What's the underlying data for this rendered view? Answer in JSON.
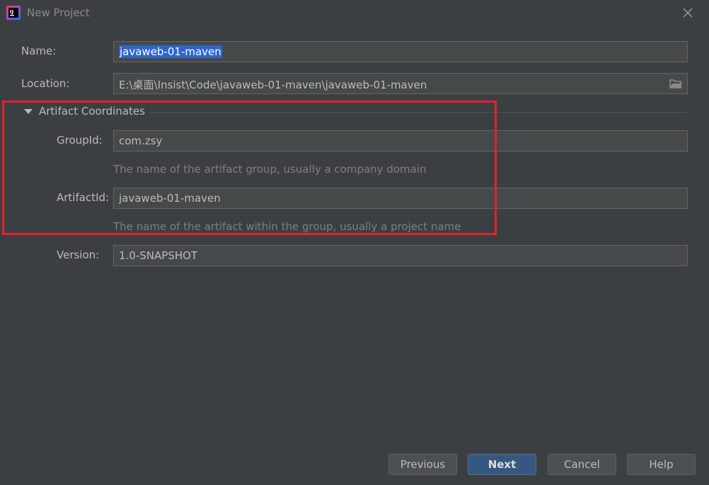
{
  "window": {
    "title": "New Project",
    "icon": "intellij-idea-icon"
  },
  "form": {
    "name_label": "Name:",
    "name_value": "javaweb-01-maven",
    "location_label": "Location:",
    "location_value": "E:\\桌面\\Insist\\Code\\javaweb-01-maven\\javaweb-01-maven",
    "section_title": "Artifact Coordinates",
    "groupid_label": "GroupId:",
    "groupid_value": "com.zsy",
    "groupid_hint": "The name of the artifact group, usually a company domain",
    "artifactid_label": "ArtifactId:",
    "artifactid_value": "javaweb-01-maven",
    "artifactid_hint": "The name of the artifact within the group, usually a project name",
    "version_label": "Version:",
    "version_value": "1.0-SNAPSHOT"
  },
  "buttons": {
    "previous": "Previous",
    "next": "Next",
    "cancel": "Cancel",
    "help": "Help"
  },
  "colors": {
    "background": "#3c3f41",
    "field_bg": "#45494a",
    "selection": "#2f65ca",
    "primary_button": "#365880",
    "highlight_box": "#e8202a"
  }
}
